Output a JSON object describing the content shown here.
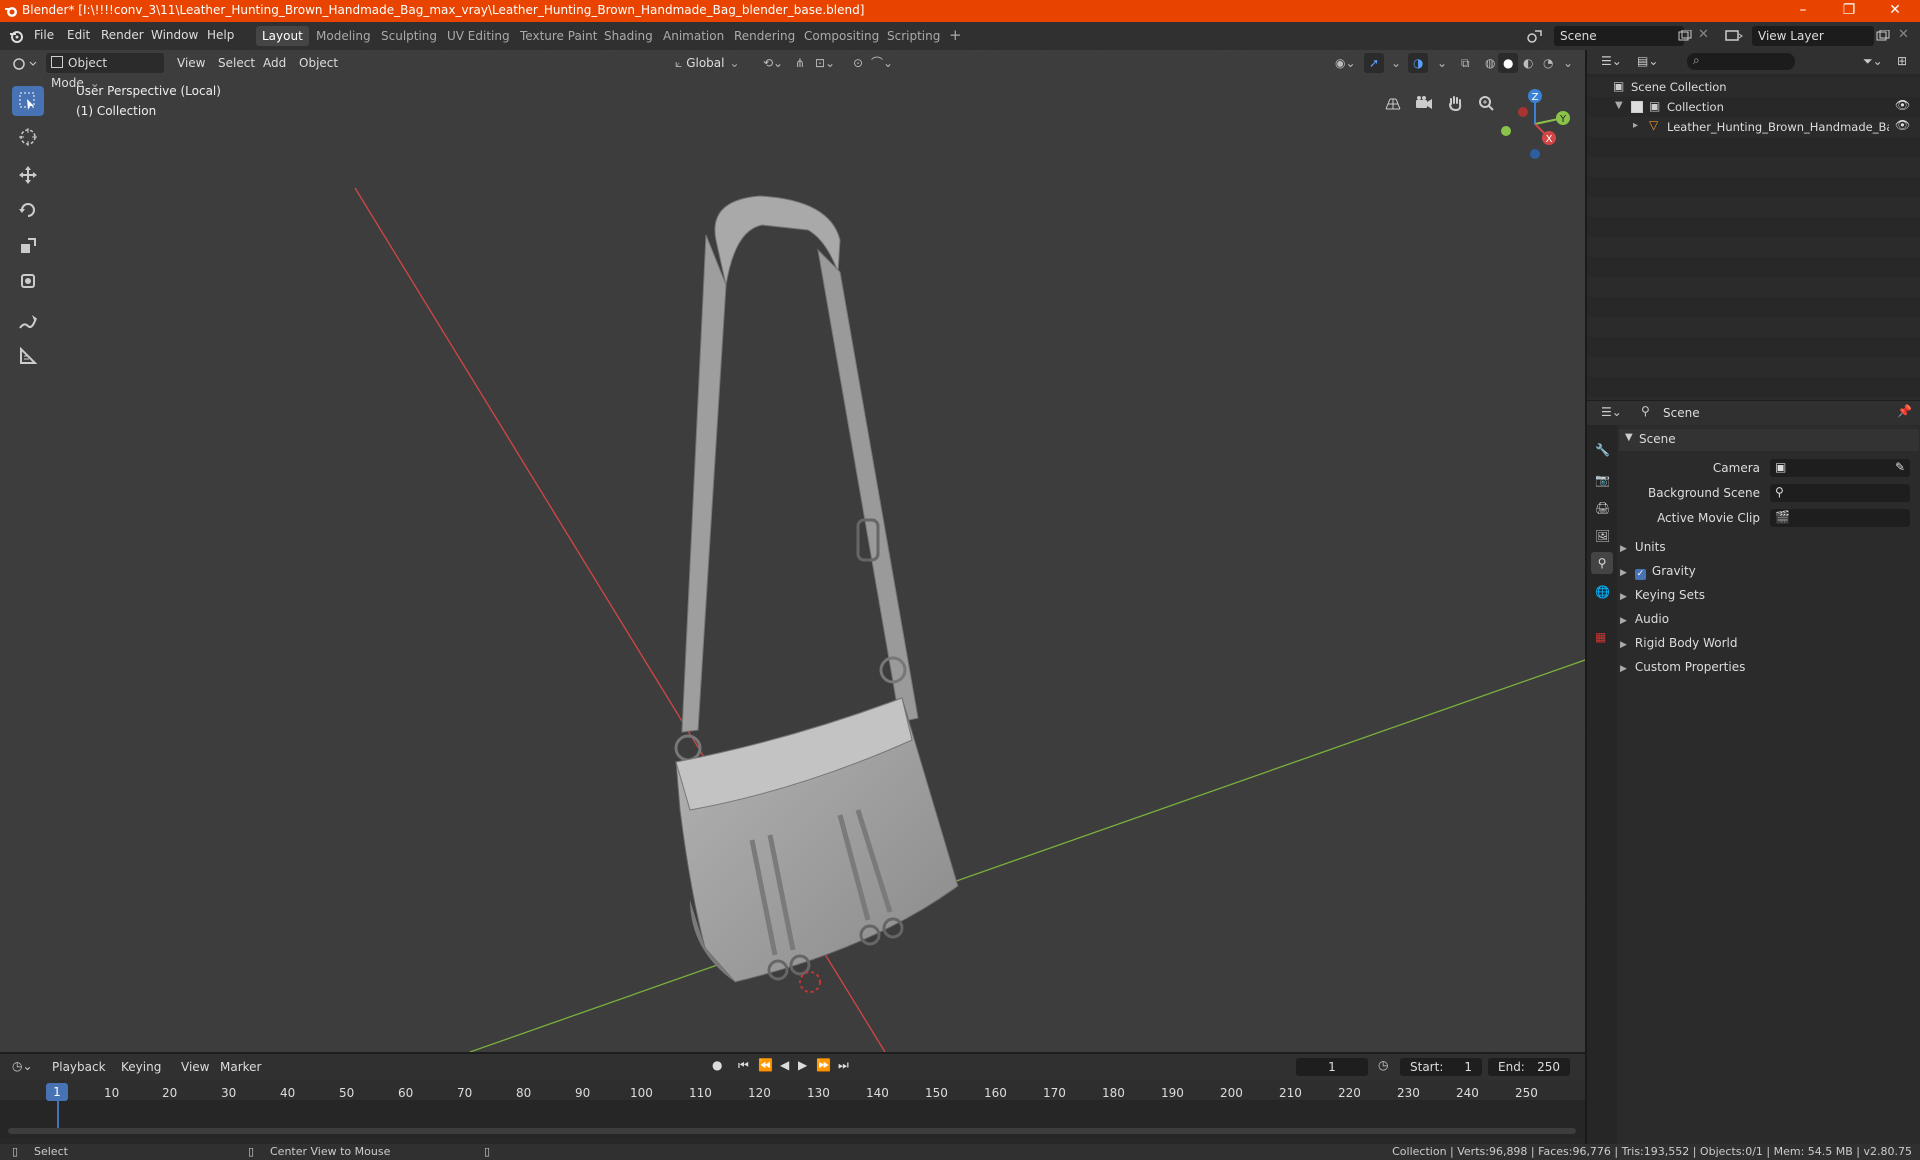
{
  "window": {
    "title": "Blender* [I:\\!!!!conv_3\\11\\Leather_Hunting_Brown_Handmade_Bag_max_vray\\Leather_Hunting_Brown_Handmade_Bag_blender_base.blend]",
    "minimize": "–",
    "restore": "❐",
    "close": "✕"
  },
  "menu": {
    "items": [
      "File",
      "Edit",
      "Render",
      "Window",
      "Help"
    ]
  },
  "workspaces": [
    "Layout",
    "Modeling",
    "Sculpting",
    "UV Editing",
    "Texture Paint",
    "Shading",
    "Animation",
    "Rendering",
    "Compositing",
    "Scripting"
  ],
  "scene": {
    "label": "Scene"
  },
  "view_layer": {
    "label": "View Layer"
  },
  "viewport": {
    "mode": "Object Mode",
    "menus": [
      "View",
      "Select",
      "Add",
      "Object"
    ],
    "transform_orientation": "Global",
    "perspective_label": "User Perspective (Local)",
    "collection_label": "(1) Collection",
    "gizmo_axes": [
      "Z",
      "Y",
      "X"
    ]
  },
  "outliner": {
    "root": "Scene Collection",
    "collection": "Collection",
    "object": "Leather_Hunting_Brown_Handmade_Bag_piv"
  },
  "properties": {
    "context": "Scene",
    "panel_title": "Scene",
    "fields": [
      {
        "label": "Camera"
      },
      {
        "label": "Background Scene"
      },
      {
        "label": "Active Movie Clip"
      }
    ],
    "sections": [
      "Units",
      "Gravity",
      "Keying Sets",
      "Audio",
      "Rigid Body World",
      "Custom Properties"
    ]
  },
  "timeline": {
    "menus": [
      "Playback",
      "Keying",
      "View",
      "Marker"
    ],
    "current_frame": "1",
    "start_label": "Start:",
    "start": "1",
    "end_label": "End:",
    "end": "250",
    "ticks": [
      "1",
      "10",
      "20",
      "30",
      "40",
      "50",
      "60",
      "70",
      "80",
      "90",
      "100",
      "110",
      "120",
      "130",
      "140",
      "150",
      "160",
      "170",
      "180",
      "190",
      "200",
      "210",
      "220",
      "230",
      "240",
      "250"
    ]
  },
  "status": {
    "select": "Select",
    "center_view": "Center View to Mouse",
    "stats": "Collection | Verts:96,898 | Faces:96,776 | Tris:193,552 | Objects:0/1 | Mem: 54.5 MB | v2.80.75"
  },
  "colors": {
    "titlebar": "#e84400",
    "accent": "#4772b3",
    "x_axis": "#d44545",
    "y_axis": "#8bc34a",
    "z_axis": "#3b82d6"
  }
}
